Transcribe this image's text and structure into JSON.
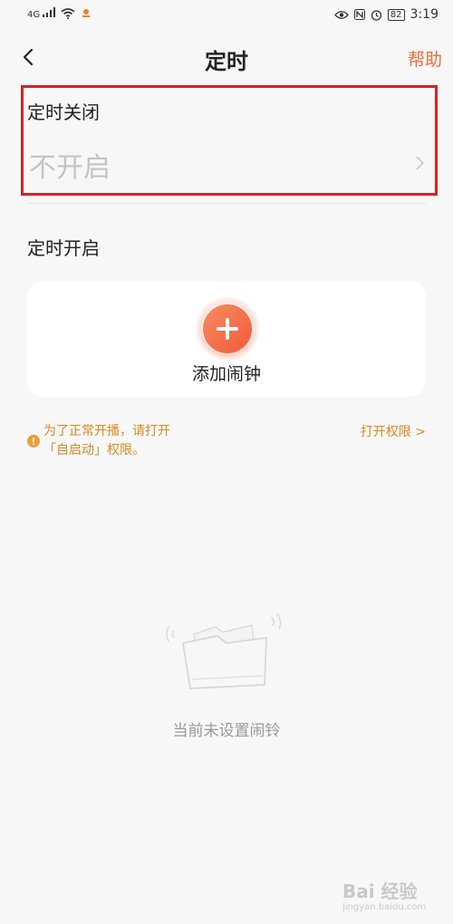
{
  "status_bar": {
    "network": "4G",
    "battery": "82",
    "time": "3:19"
  },
  "nav": {
    "title": "定时",
    "help_label": "帮助"
  },
  "timer_off": {
    "label": "定时关闭",
    "value": "不开启"
  },
  "timer_on": {
    "label": "定时开启",
    "add_alarm_label": "添加闹钟"
  },
  "notice": {
    "line1": "为了正常开播，请打开",
    "line2": "「自启动」权限。",
    "link": "打开权限 >"
  },
  "empty_state": {
    "text": "当前未设置闹铃"
  },
  "watermark": {
    "main": "Bai 经验",
    "sub": "jingyan.baidu.com"
  },
  "colors": {
    "accent": "#f06a3a",
    "notice": "#d98a24",
    "highlight": "#d8202a",
    "placeholder": "#c4c4c4"
  }
}
